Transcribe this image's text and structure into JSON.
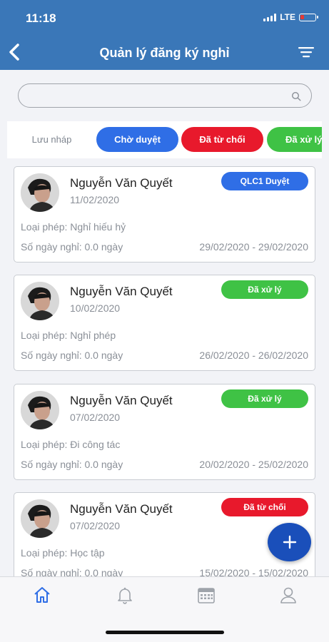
{
  "status_bar": {
    "time": "11:18",
    "network": "LTE"
  },
  "header": {
    "title": "Quản lý đăng ký nghỉ",
    "back_icon": "back-arrow-icon",
    "filter_icon": "filter-icon"
  },
  "search": {
    "placeholder": "",
    "value": ""
  },
  "tabs": [
    {
      "label": "Lưu nháp"
    },
    {
      "label": "Chờ duyệt"
    },
    {
      "label": "Đã từ chối"
    },
    {
      "label": "Đã xử lý"
    }
  ],
  "colors": {
    "header": "#3a77b8",
    "pending": "#2f6ee6",
    "rejected": "#e8192c",
    "done": "#3fc245",
    "fab": "#1a4fba"
  },
  "requests": [
    {
      "name": "Nguyễn Văn Quyết",
      "date": "11/02/2020",
      "status": "QLC1 Duyệt",
      "status_color": "#2f6ee6",
      "leave_type": "Loại phép: Nghỉ hiếu hỷ",
      "days": "Số ngày nghỉ: 0.0 ngày",
      "range": "29/02/2020 - 29/02/2020"
    },
    {
      "name": "Nguyễn Văn Quyết",
      "date": "10/02/2020",
      "status": "Đã xử lý",
      "status_color": "#3fc245",
      "leave_type": "Loại phép: Nghỉ phép",
      "days": "Số ngày nghỉ: 0.0 ngày",
      "range": "26/02/2020 - 26/02/2020"
    },
    {
      "name": "Nguyễn Văn Quyết",
      "date": "07/02/2020",
      "status": "Đã xử lý",
      "status_color": "#3fc245",
      "leave_type": "Loại phép: Đi công tác",
      "days": "Số ngày nghỉ: 0.0 ngày",
      "range": "20/02/2020 - 25/02/2020"
    },
    {
      "name": "Nguyễn Văn Quyết",
      "date": "07/02/2020",
      "status": "Đã từ chối",
      "status_color": "#e8192c",
      "leave_type": "Loại phép: Học tập",
      "days": "Số ngày nghỉ: 0.0 ngày",
      "range": "15/02/2020 - 15/02/2020"
    }
  ],
  "fab": {
    "icon": "plus-icon"
  },
  "bottom_nav": [
    {
      "icon": "home-icon",
      "active": true
    },
    {
      "icon": "bell-icon",
      "active": false
    },
    {
      "icon": "calendar-icon",
      "active": false
    },
    {
      "icon": "user-icon",
      "active": false
    }
  ]
}
